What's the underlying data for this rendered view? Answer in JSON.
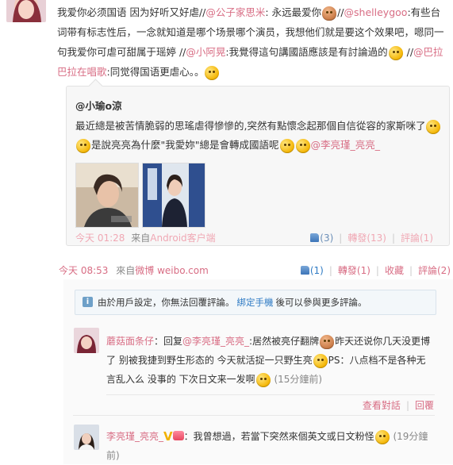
{
  "post": {
    "text_segments": [
      "我爱你必须国语 因为好听又好虐//",
      "@公子家思米",
      ": 永远最爱你",
      "//",
      "@shelleygoo",
      ":有些台词带有标志性后，一念就知道是哪个场景哪个演员，我想他们就是要这个效果吧，嗯同一句我爱你可虐可甜属于瑶婷 //",
      "@小阿晃",
      ":我覺得這句講國語應該是有討論過的",
      " //",
      "@巴拉巴拉在唱歌",
      ":同觉得国语更虐心。。"
    ]
  },
  "quote": {
    "author": "@小瑜o涼",
    "text_1": "最近總是被苦情脆弱的思瑤虐得慘慘的,突然有點懷念起那個自信從容的家斯咪了",
    "text_2": "是說亮亮為什麼\"我愛妳\"總是會轉成國語呢",
    "mention": "@李亮瑾_亮亮_",
    "time": "今天 01:28",
    "source_prefix": "来自",
    "source": "Android客户端",
    "like": "(3)",
    "repost": "轉發(13)",
    "comment": "評論(1)"
  },
  "footer": {
    "time": "今天 08:53",
    "source_prefix": "來自",
    "source": "微博 weibo.com",
    "like": "(1)",
    "repost": "轉發(1)",
    "favorite": "收藏",
    "comment": "評論(2)"
  },
  "notice": {
    "text": "由於用戶設定，你無法回覆評論。",
    "link": "綁定手機",
    "suffix": "後可以參與更多評論。"
  },
  "comments": [
    {
      "user": "蘑菇面条仔",
      "colon": "：回复",
      "mention": "@李亮瑾_亮亮_",
      "text_1": ":居然被亮仔翻牌",
      "text_2": "昨天还说你几天没更博了 别被我捷到野生形态的 今天就活捉一只野生亮",
      "text_3": "PS：八点档不是各种无言乱入么 没事的 下次日文来一发啊",
      "time": "(15分鐘前)",
      "action_1": "查看對話",
      "action_2": "回覆"
    },
    {
      "user": "李亮瑾_亮亮_",
      "text": "：我曾想過，若當下突然來個英文或日文粉怪",
      "time": "(19分鐘前)"
    }
  ]
}
